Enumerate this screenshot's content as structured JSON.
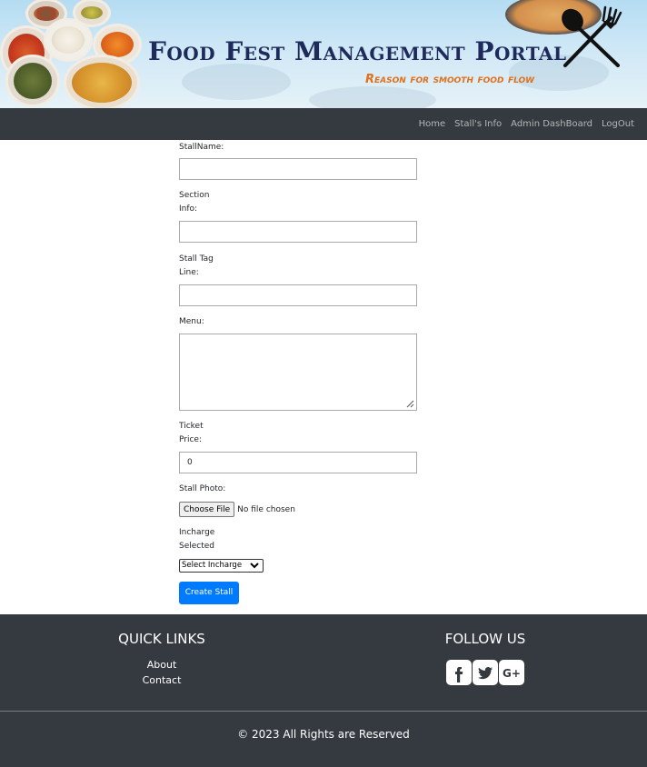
{
  "banner": {
    "title": "Food Fest Management Portal",
    "tagline": "Reason for smooth food flow"
  },
  "nav": {
    "items": [
      {
        "label": "Home"
      },
      {
        "label": "Stall's Info"
      },
      {
        "label": "Admin DashBoard"
      },
      {
        "label": "LogOut"
      }
    ]
  },
  "form": {
    "stall_name": {
      "label": "StallName:",
      "value": ""
    },
    "section_info": {
      "label_line1": "Section",
      "label_line2": "Info:",
      "value": ""
    },
    "stall_tag": {
      "label_line1": "Stall Tag",
      "label_line2": "Line:",
      "value": ""
    },
    "menu": {
      "label": "Menu:",
      "value": ""
    },
    "ticket_price": {
      "label_line1": "Ticket",
      "label_line2": "Price:",
      "value": "0"
    },
    "stall_photo": {
      "label": "Stall Photo:",
      "button": "Choose File",
      "status": "No file chosen"
    },
    "incharge": {
      "label_line1": "Incharge",
      "label_line2": "Selected",
      "selected": "Select Incharge"
    },
    "submit": "Create Stall"
  },
  "footer": {
    "quick_links_title": "QUICK LINKS",
    "links": [
      {
        "label": "About"
      },
      {
        "label": "Contact"
      }
    ],
    "follow_title": "FOLLOW US",
    "social": [
      "facebook-icon",
      "twitter-icon",
      "google-plus-icon"
    ],
    "copyright": "© 2023 All Rights are Reserved"
  },
  "colors": {
    "navbar": "#343a40",
    "primary": "#007bff",
    "title": "#1f2a5c",
    "tagline": "#e0701a"
  }
}
